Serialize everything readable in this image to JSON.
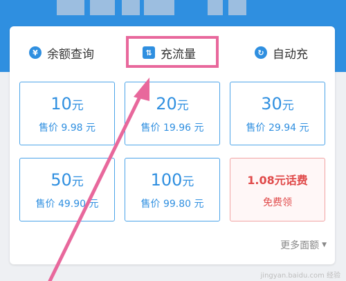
{
  "tabs": [
    {
      "label": "余额查询",
      "icon": "yen-icon"
    },
    {
      "label": "充流量",
      "icon": "data-flow-icon"
    },
    {
      "label": "自动充",
      "icon": "refresh-icon"
    }
  ],
  "tab_icon_glyphs": {
    "yen": "¥",
    "flow": "⇅",
    "refresh": "↻"
  },
  "tiles": [
    {
      "amount": "10",
      "unit": "元",
      "price": "售价 9.98 元"
    },
    {
      "amount": "20",
      "unit": "元",
      "price": "售价 19.96 元"
    },
    {
      "amount": "30",
      "unit": "元",
      "price": "售价 29.94 元"
    },
    {
      "amount": "50",
      "unit": "元",
      "price": "售价 49.90 元"
    },
    {
      "amount": "100",
      "unit": "元",
      "price": "售价 99.80 元"
    }
  ],
  "promo": {
    "title": "1.08元话费",
    "subtitle": "免费领"
  },
  "more_label": "更多面额",
  "watermark": "jingyan.baidu.com 经验",
  "colors": {
    "primary": "#2f8fe0",
    "highlight": "#e8689c",
    "promo": "#e04a4a"
  }
}
